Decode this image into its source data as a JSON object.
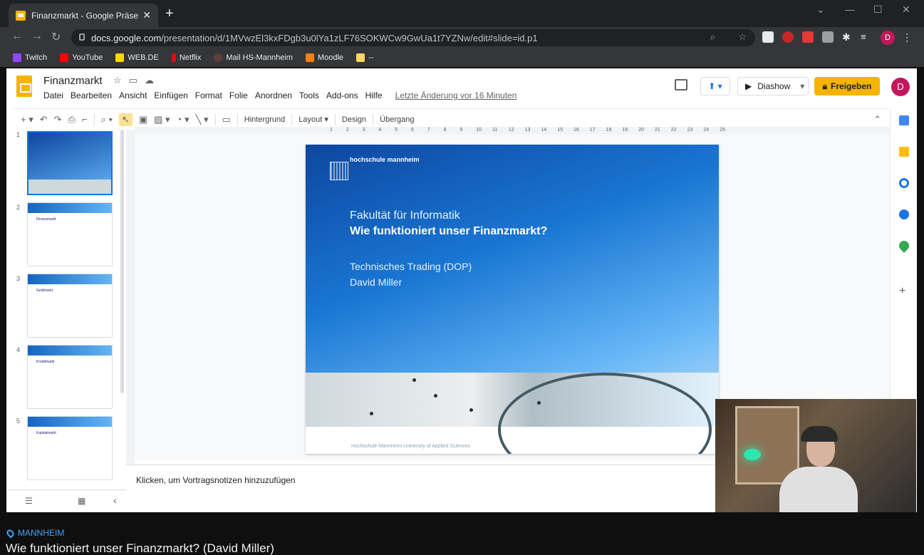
{
  "browser": {
    "tab_title": "Finanzmarkt - Google Präsentatio",
    "url_host": "docs.google.com",
    "url_path": "/presentation/d/1MVwzEl3kxFDgb3u0lYa1zLF76SOKWCw9GwUa1t7YZNw/edit#slide=id.p1",
    "bookmarks": [
      "Twitch",
      "YouTube",
      "WEB.DE",
      "Netflix",
      "Mail HS-Mannheim",
      "Moodle",
      "--"
    ],
    "profile_initial": "D"
  },
  "app": {
    "doc_title": "Finanzmarkt",
    "menu": [
      "Datei",
      "Bearbeiten",
      "Ansicht",
      "Einfügen",
      "Format",
      "Folie",
      "Anordnen",
      "Tools",
      "Add-ons",
      "Hilfe"
    ],
    "last_change": "Letzte Änderung vor 16 Minuten",
    "present_label": "Diashow",
    "share_label": "Freigeben",
    "account_initial": "D"
  },
  "toolbar": {
    "background": "Hintergrund",
    "layout": "Layout",
    "design": "Design",
    "transition": "Übergang"
  },
  "ruler": [
    "1",
    "2",
    "3",
    "4",
    "5",
    "6",
    "7",
    "8",
    "9",
    "10",
    "11",
    "12",
    "13",
    "14",
    "15",
    "16",
    "17",
    "18",
    "19",
    "20",
    "21",
    "22",
    "23",
    "24",
    "25"
  ],
  "filmstrip": {
    "slides": [
      {
        "num": "1",
        "selected": true
      },
      {
        "num": "2",
        "selected": false,
        "label": "Finanzmarkt"
      },
      {
        "num": "3",
        "selected": false,
        "label": "Geldmarkt"
      },
      {
        "num": "4",
        "selected": false,
        "label": "Kreditmarkt"
      },
      {
        "num": "5",
        "selected": false,
        "label": "Kapitalmarkt"
      }
    ]
  },
  "slide": {
    "logo_text": "hochschule mannheim",
    "subtitle": "Fakultät für Informatik",
    "title": "Wie funktioniert unser Finanzmarkt?",
    "course": "Technisches Trading (DOP)",
    "author": "David Miller",
    "footer": "Hochschule Mannheim University of Applied Sciences"
  },
  "notes": {
    "placeholder": "Klicken, um Vortragsnotizen hinzuzufügen"
  },
  "caption": {
    "location": "MANNHEIM",
    "title": "Wie funktioniert unser Finanzmarkt? (David Miller)"
  },
  "colors": {
    "accent": "#1a73e8",
    "share": "#f4b400",
    "avatar": "#c2185b",
    "location": "#3ea6ff"
  }
}
